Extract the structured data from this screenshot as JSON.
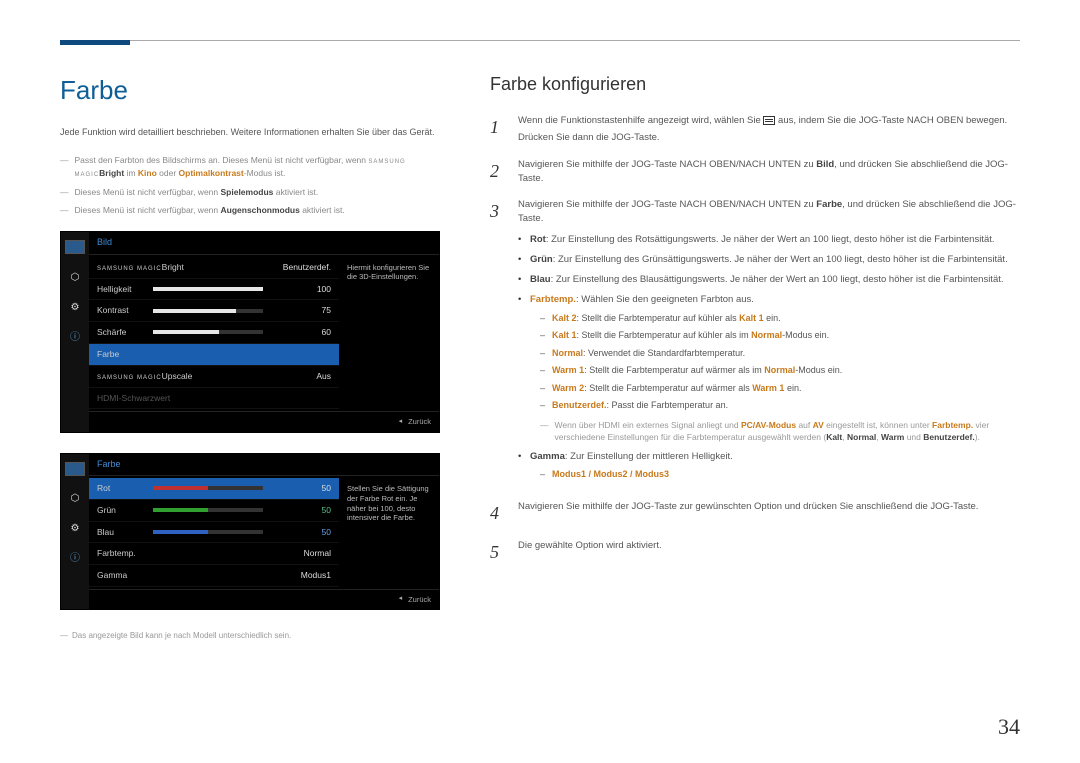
{
  "page": {
    "number": "34",
    "title": "Farbe",
    "subtitle": "Farbe konfigurieren"
  },
  "intro": "Jede Funktion wird detailliert beschrieben. Weitere Informationen erhalten Sie über das Gerät.",
  "notes": [
    {
      "pre": "Passt den Farbton des Bildschirms an. Dieses Menü ist nicht verfügbar, wenn ",
      "magic_pre": "SAMSUNG",
      "magic_post": "MAGIC",
      "bold1": "Bright",
      "mid1": " im ",
      "kw1": "Kino",
      "mid2": " oder ",
      "kw2": "Optimalkontrast",
      "end": "-Modus ist."
    },
    {
      "pre": "Dieses Menü ist nicht verfügbar, wenn ",
      "bold1": "Spielemodus",
      "end": " aktiviert ist."
    },
    {
      "pre": "Dieses Menü ist nicht verfügbar, wenn ",
      "bold1": "Augenschonmodus",
      "end": " aktiviert ist."
    }
  ],
  "osd1": {
    "category": "Bild",
    "help": "Hiermit konfigurieren Sie die 3D-Einstellungen.",
    "back_label": "Zurück",
    "rows": [
      {
        "label": "MAGIC Bright",
        "value": "Benutzerdef.",
        "magic": true
      },
      {
        "label": "Helligkeit",
        "value": "100",
        "bar": 100,
        "color": "white"
      },
      {
        "label": "Kontrast",
        "value": "75",
        "bar": 75,
        "color": "white"
      },
      {
        "label": "Schärfe",
        "value": "60",
        "bar": 60,
        "color": "white"
      },
      {
        "label": "Farbe",
        "value": "",
        "selected": true
      },
      {
        "label": "MAGIC Upscale",
        "value": "Aus",
        "magic": true
      },
      {
        "label": "HDMI-Schwarzwert",
        "value": "",
        "dim": true
      }
    ]
  },
  "osd2": {
    "category": "Farbe",
    "help": "Stellen Sie die Sättigung der Farbe Rot ein. Je näher bei 100, desto intensiver die Farbe.",
    "back_label": "Zurück",
    "rows": [
      {
        "label": "Rot",
        "value": "50",
        "bar": 50,
        "color": "red",
        "selected": true
      },
      {
        "label": "Grün",
        "value": "50",
        "bar": 50,
        "color": "green",
        "gval": true
      },
      {
        "label": "Blau",
        "value": "50",
        "bar": 50,
        "color": "blue",
        "bval": true
      },
      {
        "label": "Farbtemp.",
        "value": "Normal"
      },
      {
        "label": "Gamma",
        "value": "Modus1"
      }
    ]
  },
  "footnote": "Das angezeigte Bild kann je nach Modell unterschiedlich sein.",
  "steps": {
    "s1a": "Wenn die Funktionstastenhilfe angezeigt wird, wählen Sie ",
    "s1b": " aus, indem Sie die JOG-Taste NACH OBEN bewegen.",
    "s1c": "Drücken Sie dann die JOG-Taste.",
    "s2a": "Navigieren Sie mithilfe der JOG-Taste NACH OBEN/NACH UNTEN zu ",
    "s2kw": "Bild",
    "s2b": ", und drücken Sie abschließend die JOG-Taste.",
    "s3a": "Navigieren Sie mithilfe der JOG-Taste NACH OBEN/NACH UNTEN zu ",
    "s3kw": "Farbe",
    "s3b": ", und drücken Sie abschließend die JOG-Taste.",
    "s4": "Navigieren Sie mithilfe der JOG-Taste zur gewünschten Option und drücken Sie anschließend die JOG-Taste.",
    "s5": "Die gewählte Option wird aktiviert."
  },
  "details": {
    "rot_kw": "Rot",
    "rot_txt": ": Zur Einstellung des Rotsättigungswerts. Je näher der Wert an 100 liegt, desto höher ist die Farbintensität.",
    "gruen_kw": "Grün",
    "gruen_txt": ": Zur Einstellung des Grünsättigungswerts. Je näher der Wert an 100 liegt, desto höher ist die Farbintensität.",
    "blau_kw": "Blau",
    "blau_txt": ": Zur Einstellung des Blausättigungswerts. Je näher der Wert an 100 liegt, desto höher ist die Farbintensität.",
    "ft_kw": "Farbtemp.",
    "ft_txt": ": Wählen Sie den geeigneten Farbton aus.",
    "kalt2_kw": "Kalt 2",
    "kalt2_txt": ": Stellt die Farbtemperatur auf kühler als ",
    "kalt2_ref": "Kalt 1",
    "kalt2_end": " ein.",
    "kalt1_kw": "Kalt 1",
    "kalt1_txt": ": Stellt die Farbtemperatur auf kühler als im ",
    "kalt1_ref": "Normal",
    "kalt1_end": "-Modus ein.",
    "normal_kw": "Normal",
    "normal_txt": ": Verwendet die Standardfarbtemperatur.",
    "warm1_kw": "Warm 1",
    "warm1_txt": ": Stellt die Farbtemperatur auf wärmer als im ",
    "warm1_ref": "Normal",
    "warm1_end": "-Modus ein.",
    "warm2_kw": "Warm 2",
    "warm2_txt": ": Stellt die Farbtemperatur auf wärmer als ",
    "warm2_ref": "Warm 1",
    "warm2_end": " ein.",
    "ben_kw": "Benutzerdef.",
    "ben_txt": ": Passt die Farbtemperatur an.",
    "hdmi_pre": "Wenn über HDMI ein externes Signal anliegt und ",
    "hdmi_kw1": "PC/AV-Modus",
    "hdmi_mid1": " auf ",
    "hdmi_kw2": "AV",
    "hdmi_mid2": " eingestellt ist, können unter ",
    "hdmi_kw3": "Farbtemp.",
    "hdmi_mid3": " vier verschiedene Einstellungen für die Farbtemperatur ausgewählt werden (",
    "hdmi_k": "Kalt",
    "hdmi_c1": ", ",
    "hdmi_n": "Normal",
    "hdmi_c2": ", ",
    "hdmi_w": "Warm",
    "hdmi_c3": " und ",
    "hdmi_b": "Benutzerdef.",
    "hdmi_end": ").",
    "gamma_kw": "Gamma",
    "gamma_txt": ": Zur Einstellung der mittleren Helligkeit.",
    "gamma_modes": "Modus1 / Modus2 / Modus3"
  }
}
